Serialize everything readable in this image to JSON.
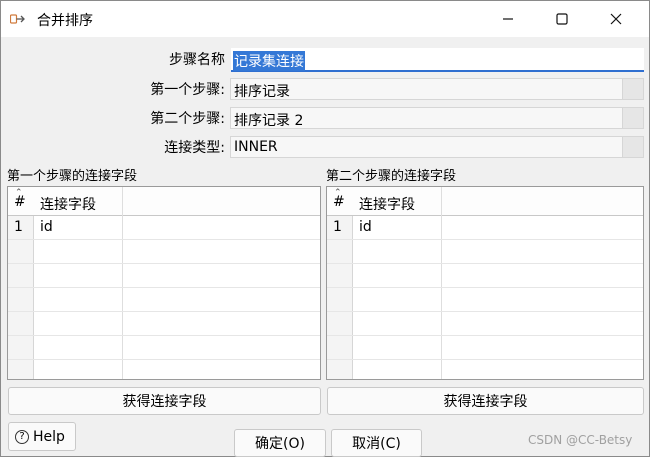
{
  "window": {
    "title": "合并排序",
    "icons": {
      "app": "merge-join-icon",
      "minimize": "minimize-icon",
      "maximize": "maximize-icon",
      "close": "close-icon"
    }
  },
  "form": {
    "step_name_label": "步骤名称",
    "step_name_value": "记录集连接",
    "first_step_label": "第一个步骤:",
    "first_step_value": "排序记录",
    "second_step_label": "第二个步骤:",
    "second_step_value": "排序记录 2",
    "join_type_label": "连接类型:",
    "join_type_value": "INNER"
  },
  "left_panel": {
    "title": "第一个步骤的连接字段",
    "columns": [
      "#",
      "连接字段"
    ],
    "rows": [
      [
        "1",
        "id"
      ]
    ],
    "get_fields_button": "获得连接字段"
  },
  "right_panel": {
    "title": "第二个步骤的连接字段",
    "columns": [
      "#",
      "连接字段"
    ],
    "rows": [
      [
        "1",
        "id"
      ]
    ],
    "get_fields_button": "获得连接字段"
  },
  "footer": {
    "help": "Help",
    "ok": "确定(O)",
    "cancel": "取消(C)",
    "watermark": "CSDN @CC-Betsy"
  }
}
